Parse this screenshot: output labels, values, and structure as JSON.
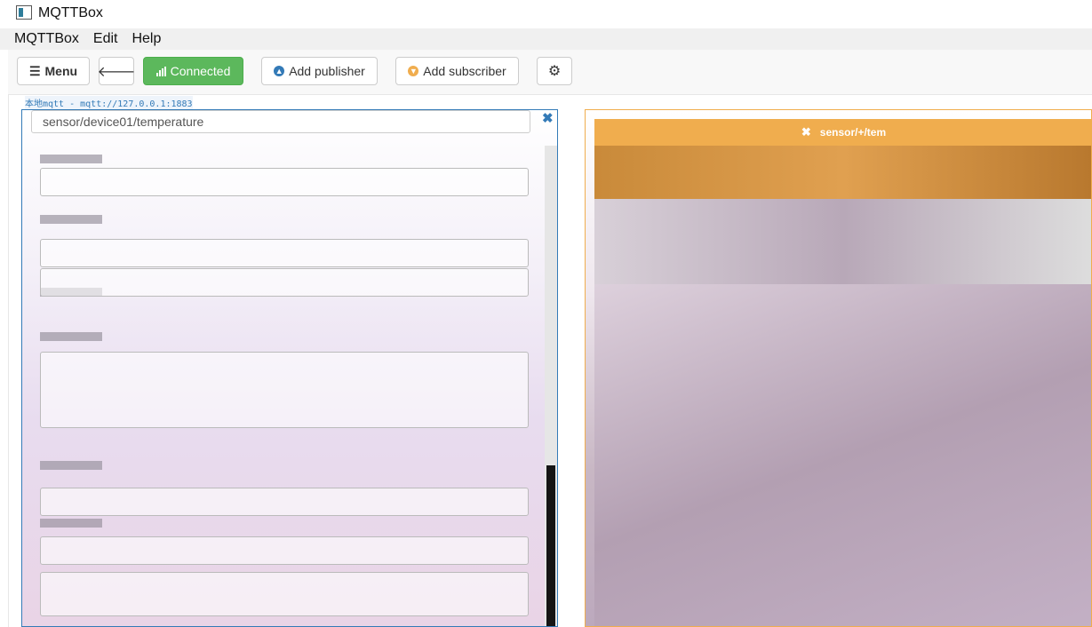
{
  "window": {
    "title": "MQTTBox"
  },
  "menubar": {
    "items": [
      "MQTTBox",
      "Edit",
      "Help"
    ]
  },
  "toolbar": {
    "menu_label": "Menu",
    "connected_label": "Connected",
    "add_publisher_label": "Add publisher",
    "add_subscriber_label": "Add subscriber",
    "colors": {
      "connected": "#5cb85c",
      "publisher_accent": "#337ab7",
      "subscriber_accent": "#f0ad4e"
    },
    "icons": [
      "hamburger-icon",
      "arrow-left-icon",
      "signal-icon",
      "arrow-circle-up-icon",
      "arrow-circle-down-icon",
      "gear-icon"
    ]
  },
  "client": {
    "label": "本地mqtt - mqtt://127.0.0.1:1883"
  },
  "publisher": {
    "topic_value": "sensor/device01/temperature"
  },
  "subscriber": {
    "topic_label": "sensor/+/tem"
  }
}
